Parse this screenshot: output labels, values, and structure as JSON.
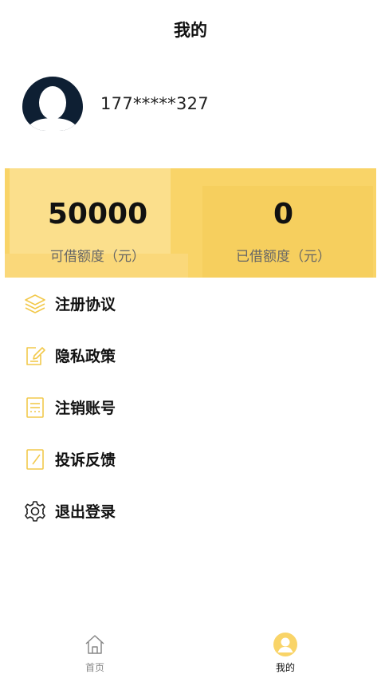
{
  "header": {
    "title": "我的"
  },
  "profile": {
    "phone": "177*****327"
  },
  "quota": {
    "available_value": "50000",
    "available_label": "可借额度（元）",
    "borrowed_value": "0",
    "borrowed_label": "已借额度（元）"
  },
  "menu": {
    "items": [
      {
        "label": "注册协议",
        "icon": "layers-icon"
      },
      {
        "label": "隐私政策",
        "icon": "edit-note-icon"
      },
      {
        "label": "注销账号",
        "icon": "document-icon"
      },
      {
        "label": "投诉反馈",
        "icon": "pencil-note-icon"
      },
      {
        "label": "退出登录",
        "icon": "gear-icon"
      }
    ]
  },
  "tabbar": {
    "tabs": [
      {
        "label": "首页",
        "icon": "home-icon",
        "active": false
      },
      {
        "label": "我的",
        "icon": "user-icon",
        "active": true
      }
    ]
  },
  "colors": {
    "accent": "#f9d468",
    "accent_light": "#fbdf8c",
    "icon_line": "#f2c94c",
    "avatar_dark": "#0e1f33"
  }
}
